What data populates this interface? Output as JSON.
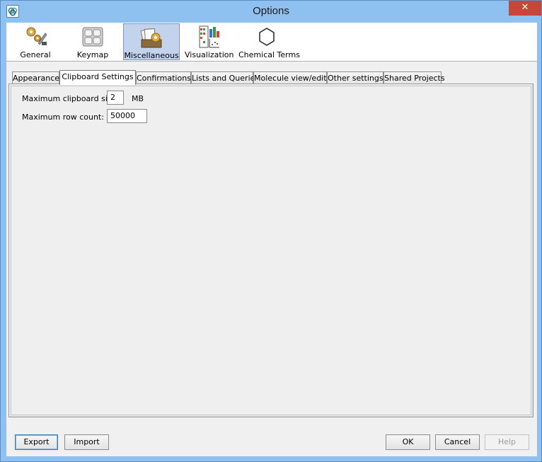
{
  "window": {
    "title": "Options",
    "close_label": "✕"
  },
  "toolbar": {
    "items": [
      {
        "label": "General",
        "icon": "gears-wrench-icon",
        "selected": false
      },
      {
        "label": "Keymap",
        "icon": "keyboard-keys-icon",
        "selected": false
      },
      {
        "label": "Miscellaneous",
        "icon": "folder-gear-icon",
        "selected": true
      },
      {
        "label": "Visualization",
        "icon": "chart-visualization-icon",
        "selected": false
      },
      {
        "label": "Chemical Terms",
        "icon": "benzene-ring-icon",
        "selected": false
      }
    ]
  },
  "tabs": {
    "items": [
      {
        "label": "Appearance",
        "active": false
      },
      {
        "label": "Clipboard Settings",
        "active": true
      },
      {
        "label": "Confirmations",
        "active": false
      },
      {
        "label": "Lists and Queries",
        "active": false
      },
      {
        "label": "Molecule view/edit",
        "active": false
      },
      {
        "label": "Other settings",
        "active": false
      },
      {
        "label": "Shared Projects",
        "active": false
      }
    ]
  },
  "clipboard": {
    "max_size_label": "Maximum clipboard size:",
    "max_size_value": "2",
    "max_size_unit": "MB",
    "max_rows_label": "Maximum row count:",
    "max_rows_value": "50000"
  },
  "buttons": {
    "export": "Export",
    "import": "Import",
    "ok": "OK",
    "cancel": "Cancel",
    "help": "Help"
  },
  "colors": {
    "window_frame": "#8ec1ef",
    "close_button": "#c7463a",
    "selected_toolbar": "#c3d3ec"
  }
}
